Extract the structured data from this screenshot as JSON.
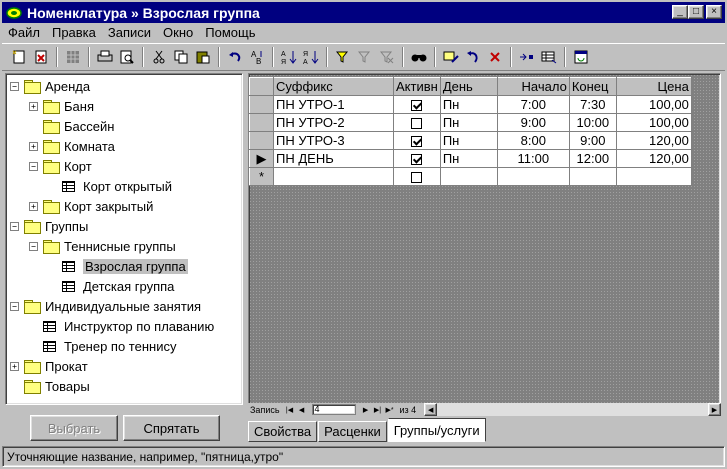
{
  "window": {
    "title": "Номенклатура » Взрослая группа",
    "minimize": "_",
    "maximize": "□",
    "close": "×"
  },
  "menu": [
    "Файл",
    "Правка",
    "Записи",
    "Окно",
    "Помощь"
  ],
  "tree": {
    "items": [
      {
        "label": "Аренда",
        "expander": "−"
      },
      {
        "label": "Баня",
        "expander": "+"
      },
      {
        "label": "Бассейн",
        "expander": ""
      },
      {
        "label": "Комната",
        "expander": "+"
      },
      {
        "label": "Корт",
        "expander": "−"
      },
      {
        "label": "Корт открытый",
        "expander": ""
      },
      {
        "label": "Корт закрытый",
        "expander": "+"
      },
      {
        "label": "Группы",
        "expander": "−"
      },
      {
        "label": "Теннисные группы",
        "expander": "−"
      },
      {
        "label": "Взрослая группа",
        "expander": ""
      },
      {
        "label": "Детская группа",
        "expander": ""
      },
      {
        "label": "Индивидуальные занятия",
        "expander": "−"
      },
      {
        "label": "Инструктор по плаванию",
        "expander": ""
      },
      {
        "label": "Тренер по теннису",
        "expander": ""
      },
      {
        "label": "Прокат",
        "expander": "+"
      },
      {
        "label": "Товары",
        "expander": ""
      }
    ]
  },
  "buttons": {
    "select": "Выбрать",
    "hide": "Спрятать"
  },
  "grid": {
    "columns": [
      "Суффикс",
      "Активн",
      "День",
      "Начало",
      "Конец",
      "Цена"
    ],
    "rows": [
      {
        "selector": "",
        "suffix": "ПН УТРО-1",
        "active": true,
        "day": "Пн",
        "start": "7:00",
        "end": "7:30",
        "price": "100,00"
      },
      {
        "selector": "",
        "suffix": "ПН УТРО-2",
        "active": false,
        "day": "Пн",
        "start": "9:00",
        "end": "10:00",
        "price": "100,00"
      },
      {
        "selector": "",
        "suffix": "ПН УТРО-3",
        "active": true,
        "day": "Пн",
        "start": "8:00",
        "end": "9:00",
        "price": "120,00"
      },
      {
        "selector": "▶",
        "suffix": "ПН ДЕНЬ",
        "active": true,
        "day": "Пн",
        "start": "11:00",
        "end": "12:00",
        "price": "120,00"
      }
    ],
    "new_row_marker": "*"
  },
  "navigator": {
    "label": "Запись",
    "current": "4",
    "of_label": "из 4"
  },
  "tabs": [
    "Свойства",
    "Расценки",
    "Группы/услуги"
  ],
  "status": "Уточняющие название, например, \"пятница,утро\""
}
